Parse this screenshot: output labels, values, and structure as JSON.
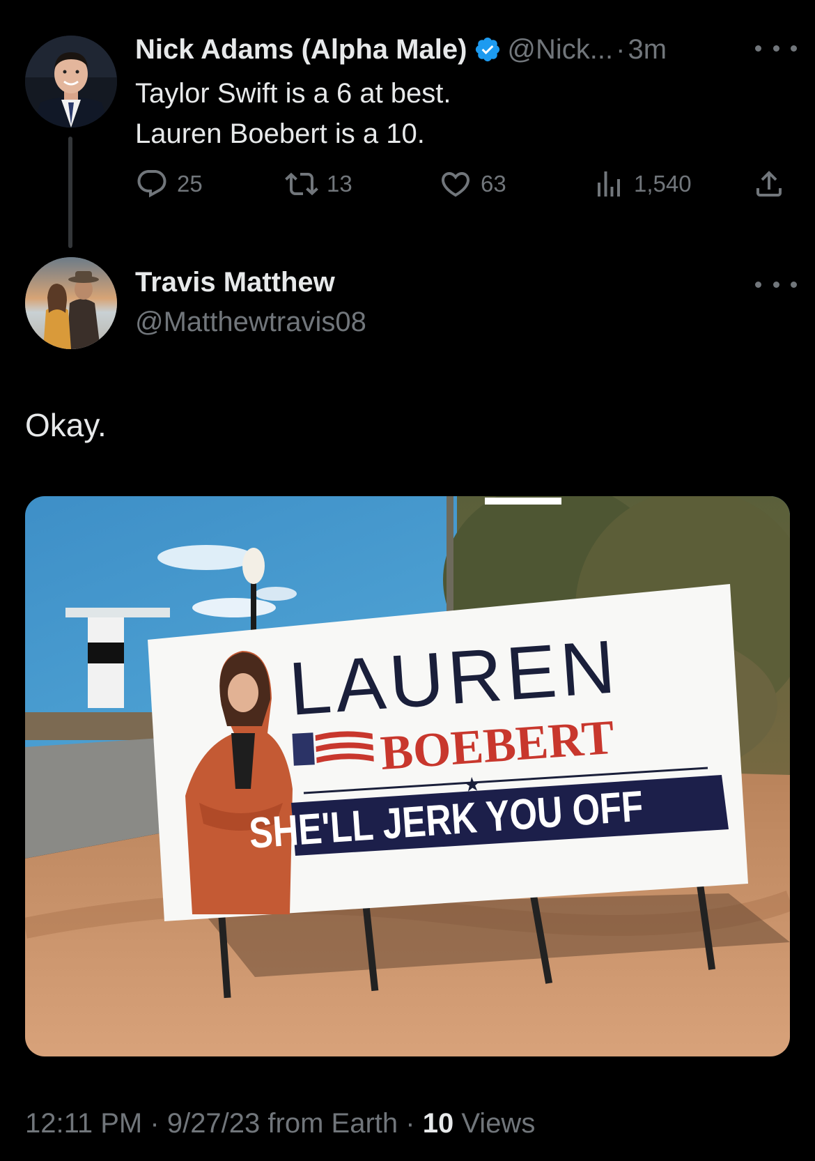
{
  "tweet1": {
    "name": "Nick Adams (Alpha Male)",
    "handle": "@Nick...",
    "separator": "·",
    "time": "3m",
    "lines": [
      "Taylor Swift is a 6 at best.",
      "Lauren Boebert is a 10."
    ],
    "actions": {
      "replies": "25",
      "retweets": "13",
      "likes": "63",
      "views": "1,540"
    },
    "icons": [
      "verified-badge-icon",
      "reply-icon",
      "retweet-icon",
      "like-icon",
      "views-icon",
      "share-icon",
      "more-icon"
    ]
  },
  "tweet2": {
    "name": "Travis Matthew",
    "handle": "@Matthewtravis08",
    "text": "Okay.",
    "media": {
      "sign_line1": "LAUREN",
      "sign_line2": "BOEBERT",
      "sign_banner": "SHE'LL JERK YOU OFF"
    },
    "footer": {
      "time": "12:11 PM",
      "dot1": "·",
      "date": "9/27/23",
      "source": "from Earth",
      "dot2": "·",
      "views_count": "10",
      "views_label": "Views"
    }
  },
  "colors": {
    "background": "#000000",
    "primary_text": "#e7e9ea",
    "secondary_text": "#71767b",
    "verified_blue": "#1d9bf0"
  }
}
